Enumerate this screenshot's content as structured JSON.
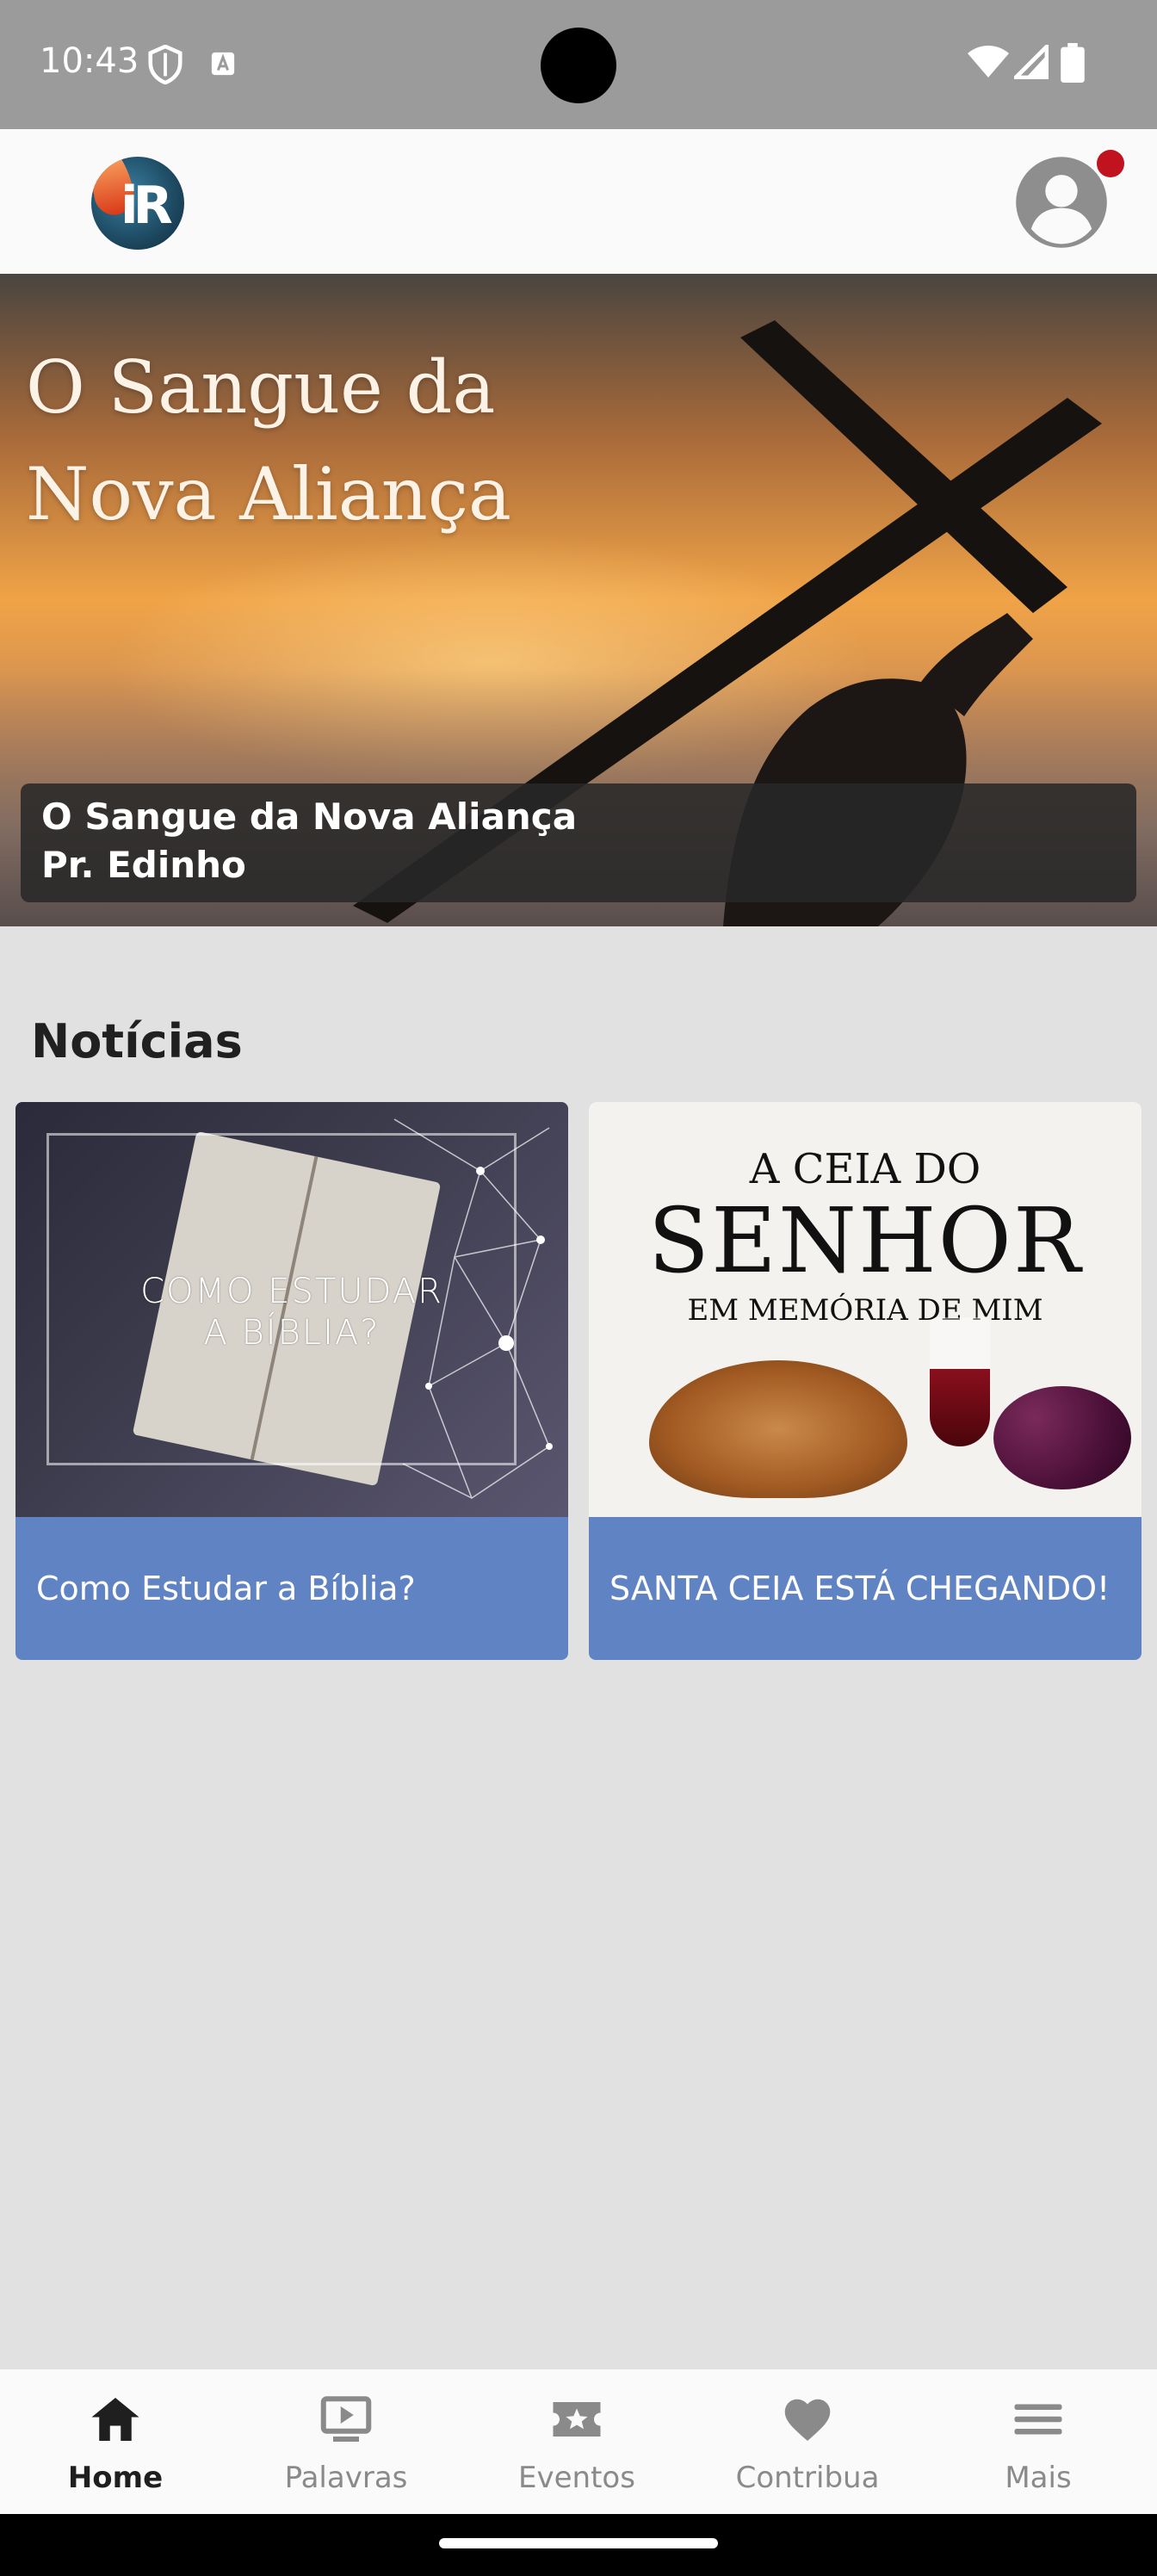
{
  "status_bar": {
    "time": "10:43",
    "icons": [
      "shield-icon",
      "a-icon",
      "wifi-icon",
      "signal-icon",
      "battery-icon"
    ]
  },
  "app_bar": {
    "logo_mark": "iR",
    "has_notification": true,
    "colors": {
      "notification_dot": "#c1121f"
    }
  },
  "hero": {
    "image_title_line1": "O Sangue da",
    "image_title_line2": "Nova Aliança",
    "caption_line1": "O Sangue da Nova Aliança",
    "caption_line2": "Pr. Edinho"
  },
  "news": {
    "title": "Notícias",
    "cards": [
      {
        "image_text_line1": "COMO ESTUDAR",
        "image_text_line2": "A BÍBLIA?",
        "label": "Como Estudar a Bíblia?"
      },
      {
        "image_text_line1": "A CEIA DO",
        "image_text_line2": "SENHOR",
        "image_text_line3": "EM MEMÓRIA DE MIM",
        "label": "SANTA CEIA ESTÁ CHEGANDO!"
      }
    ],
    "colors": {
      "card_label_bg": "#6083c3"
    }
  },
  "bottom_nav": {
    "items": [
      {
        "label": "Home",
        "icon": "home-icon",
        "active": true
      },
      {
        "label": "Palavras",
        "icon": "play-screen-icon",
        "active": false
      },
      {
        "label": "Eventos",
        "icon": "ticket-star-icon",
        "active": false
      },
      {
        "label": "Contribua",
        "icon": "heart-icon",
        "active": false
      },
      {
        "label": "Mais",
        "icon": "menu-icon",
        "active": false
      }
    ]
  }
}
